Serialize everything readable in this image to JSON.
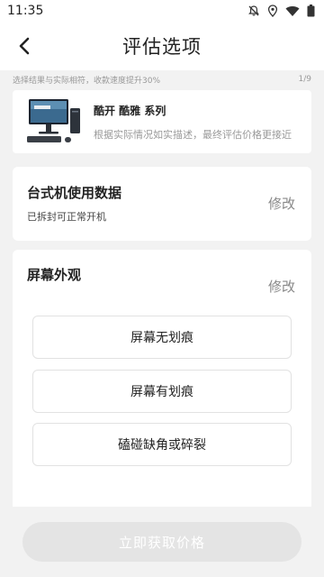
{
  "status_bar": {
    "time": "11:35",
    "icons": [
      "notifications-off-icon",
      "location-icon",
      "wifi-icon",
      "battery-icon"
    ]
  },
  "header": {
    "title": "评估选项",
    "back_icon": "chevron-left-icon"
  },
  "hint": {
    "text": "选择结果与实际相符，收款速度提升30%",
    "progress": "1/9"
  },
  "product": {
    "name": "酷开 酷雅 系列",
    "description": "根据实际情况如实描述，最终评估价格更接近"
  },
  "sections": {
    "desktop_usage": {
      "title": "台式机使用数据",
      "subtitle": "已拆封可正常开机",
      "edit_label": "修改"
    },
    "screen_appearance": {
      "title": "屏幕外观",
      "edit_label": "修改",
      "options": [
        "屏幕无划痕",
        "屏幕有划痕",
        "磕碰缺角或碎裂"
      ]
    }
  },
  "cta": {
    "label": "立即获取价格"
  },
  "colors": {
    "background": "#f2f2f2",
    "card": "#ffffff",
    "cta_disabled": "#e4e4e4",
    "muted_text": "#999999"
  }
}
